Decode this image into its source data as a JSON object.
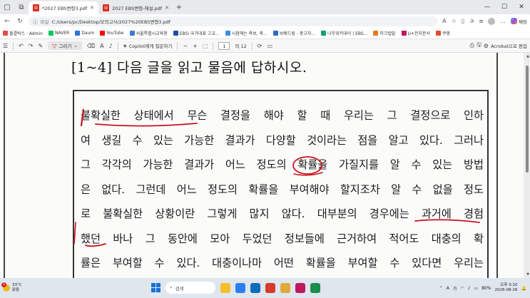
{
  "browser": {
    "tabs": [
      {
        "title": "*2027 EBS변형3.pdf",
        "active": true
      },
      {
        "title": "2027 EBS변형-해설.pdf",
        "active": false
      }
    ],
    "url_label": "파일",
    "url": "C:/Users/pc/Desktop/모의고사/2027%20EBS변형3.pdf",
    "copilot_label": "채팅",
    "bookmarks": [
      {
        "label": "출결박스 · Admin",
        "color": "#e04c4c"
      },
      {
        "label": "NAVER",
        "color": "#03c75a"
      },
      {
        "label": "Daum",
        "color": "#2f6fde"
      },
      {
        "label": "YouTube",
        "color": "#ff0000"
      },
      {
        "label": "서울특별시교육청",
        "color": "#3a7bd5"
      },
      {
        "label": "EBSi 국가대표 고교...",
        "color": "#1a4fa0"
      },
      {
        "label": "시험에는 축보, 축...",
        "color": "#3c8ee0"
      },
      {
        "label": "보배드림 - 중고자...",
        "color": "#2b6cc4"
      },
      {
        "label": "나무위키대이 | EBS...",
        "color": "#14a06e"
      },
      {
        "label": "미끄럽밭",
        "color": "#e57b1d"
      },
      {
        "label": "U+전지문서",
        "color": "#c0185d"
      },
      {
        "label": "쿠팡",
        "color": "#e44d26"
      }
    ]
  },
  "pdf_toolbar": {
    "draw_label": "그리기",
    "ask_label": "Copilot에게 질문하기",
    "zoom_minus": "−",
    "zoom_plus": "+",
    "page_current": "1",
    "page_total": "의 12",
    "acrobat_label": "Acrobat으로 편집"
  },
  "document": {
    "heading": "[1~4] 다음 글을 읽고 물음에 답하시오.",
    "lines": [
      "불확실한 상태에서 무슨 결정을 해야 할 때 우리는 그 결정으로 인하",
      "여 생길 수 있는 가능한 결과가 다양할 것이라는 점을 알고 있다. 그러나",
      "그 각각의 가능한 결과가 어느 정도의 확률을 가질지를 알 수 있는 방법",
      "은 없다. 그런데 어느 정도의 확률을 부여해야 할지조차 알 수 없을 정도",
      "로 불확실한 상황이란 그렇게 많지 않다. 대부분의 경우에는 과거에 경험",
      "했던 바나 그 동안에 모아 두었던 정보들에 근거하여 적어도 대충의 확",
      "률은 부여할 수 있다. 대충이나마 어떤 확률을 부여할 수 있다면 우리는"
    ],
    "annotation_color": "#c8141b"
  },
  "taskbar": {
    "temperature": "33°C",
    "weather": "맑음",
    "alert_count": "1",
    "search_label": "검색",
    "battery": "80%",
    "ime": "가",
    "ime2": "A",
    "time": "오후 3:10",
    "date": "2026-08-26",
    "apps": [
      "#f3c02b",
      "#2a7ef0",
      "#0f6cbd",
      "#d63a2a",
      "#e0a93a",
      "#c0185d",
      "#1a8d4f"
    ]
  }
}
